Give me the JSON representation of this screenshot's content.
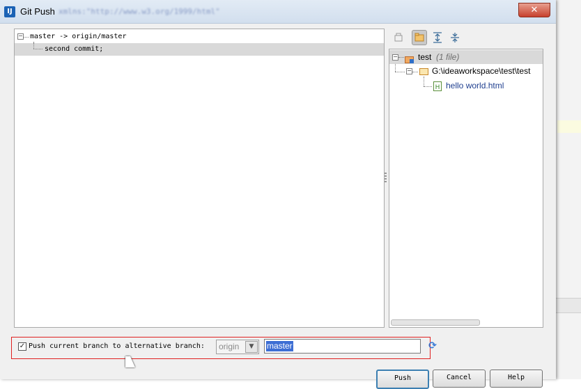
{
  "window": {
    "title": "Git Push",
    "app_icon": "intellij-idea-icon",
    "background_text": "xmlns:\"http://www.w3.org/1999/html\""
  },
  "commits": {
    "branch_row": "master -> origin/master",
    "commit_row": "second commit;"
  },
  "files": {
    "toolbar_icons": [
      "show-diff-icon",
      "group-by-directory-icon",
      "expand-all-icon",
      "collapse-all-icon"
    ],
    "root_name": "test",
    "root_count": "(1 file)",
    "folder_path": "G:\\ideaworkspace\\test\\test",
    "file_name": "hello world.html",
    "file_color": "#1f3f8f"
  },
  "push_options": {
    "checkbox_label": "Push current branch to alternative branch:",
    "checked": true,
    "remote_value": "origin",
    "branch_value": "master"
  },
  "buttons": {
    "push": "Push",
    "cancel": "Cancel",
    "help": "Help"
  },
  "colors": {
    "accent": "#3d6ed4",
    "highlight_border": "#e02020"
  }
}
